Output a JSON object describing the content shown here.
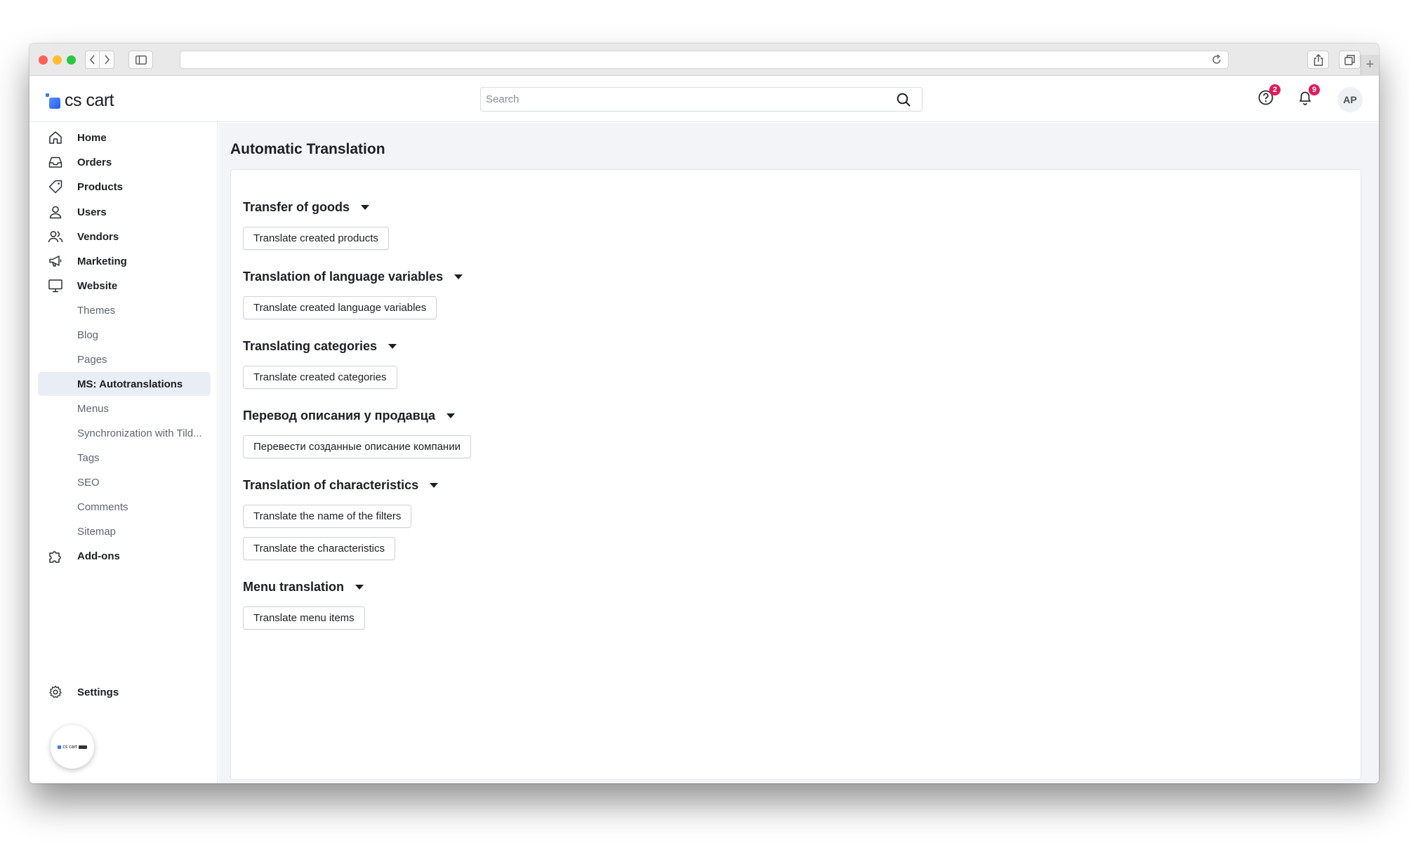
{
  "browser": {
    "address": ""
  },
  "topbar": {
    "logo_text": "cs cart",
    "search_placeholder": "Search",
    "help_badge": "2",
    "notifications_badge": "9",
    "avatar_initials": "AP"
  },
  "sidebar": {
    "items": [
      {
        "label": "Home"
      },
      {
        "label": "Orders"
      },
      {
        "label": "Products"
      },
      {
        "label": "Users"
      },
      {
        "label": "Vendors"
      },
      {
        "label": "Marketing"
      },
      {
        "label": "Website"
      }
    ],
    "website_subitems": [
      {
        "label": "Themes"
      },
      {
        "label": "Blog"
      },
      {
        "label": "Pages"
      },
      {
        "label": "MS: Autotranslations"
      },
      {
        "label": "Menus"
      },
      {
        "label": "Synchronization with Tild..."
      },
      {
        "label": "Tags"
      },
      {
        "label": "SEO"
      },
      {
        "label": "Comments"
      },
      {
        "label": "Sitemap"
      }
    ],
    "addons": "Add-ons",
    "settings": "Settings",
    "fab_logo_text": "cs cart"
  },
  "main": {
    "title": "Automatic Translation",
    "sections": [
      {
        "title": "Transfer of goods",
        "buttons": [
          "Translate created products"
        ]
      },
      {
        "title": "Translation of language variables",
        "buttons": [
          "Translate created language variables"
        ]
      },
      {
        "title": "Translating categories",
        "buttons": [
          "Translate created categories"
        ]
      },
      {
        "title": "Перевод описания у продавца",
        "buttons": [
          "Перевести созданные описание компании"
        ]
      },
      {
        "title": "Translation of characteristics",
        "buttons": [
          "Translate the name of the filters",
          "Translate the characteristics"
        ]
      },
      {
        "title": "Menu translation",
        "buttons": [
          "Translate menu items"
        ]
      }
    ]
  },
  "colors": {
    "accent": "#3c77f2",
    "badge": "#e3195a",
    "active_bg": "#e9eef6",
    "main_bg": "#f2f4f8"
  }
}
